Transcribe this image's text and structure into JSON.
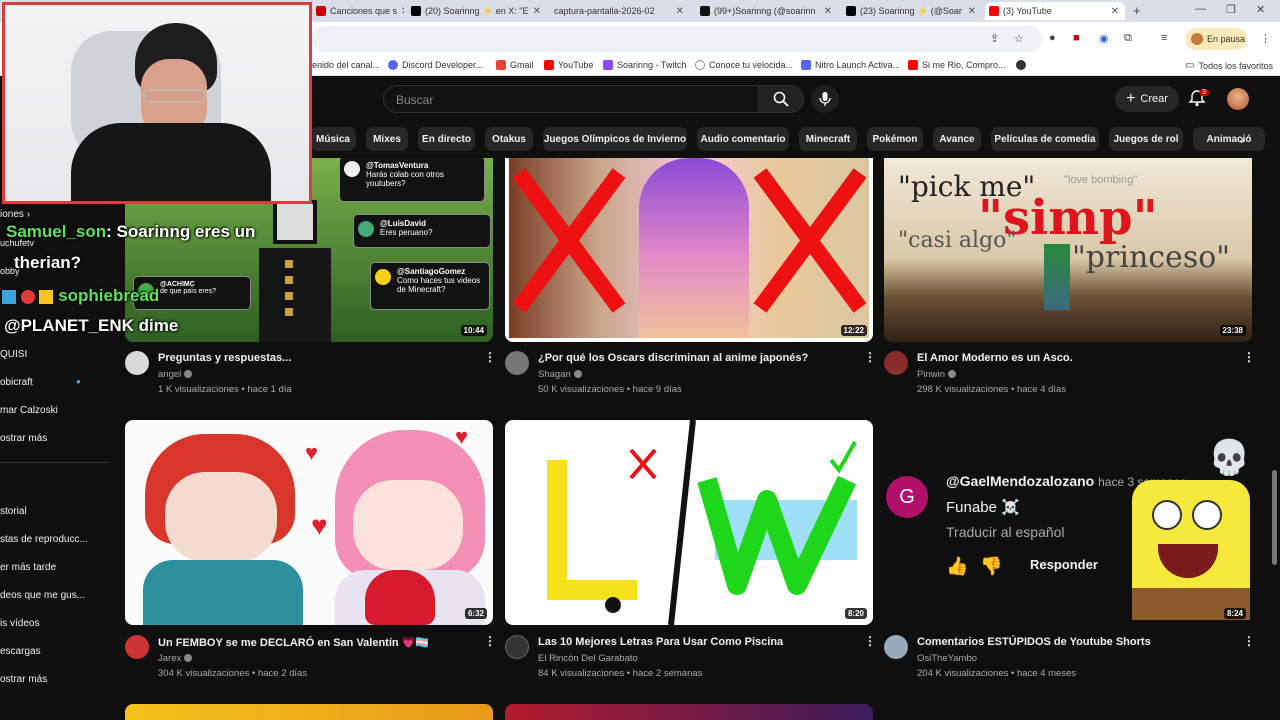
{
  "browser": {
    "tabs": [
      {
        "label": "Canciones que s"
      },
      {
        "label": "(20) Soarinng ⚡ en X: \"E"
      },
      {
        "label": "captura-pantalla-2026-02"
      },
      {
        "label": "(99+)Soarinng (@soarinn"
      },
      {
        "label": "(23) Soarinng ⚡ (@Soar"
      },
      {
        "label": "(3) YouTube"
      }
    ],
    "new_tab": "+",
    "pause_label": "En pausa",
    "bookmarks": [
      {
        "label": "enido del canal..."
      },
      {
        "label": "Discord Developer..."
      },
      {
        "label": "Gmail"
      },
      {
        "label": "YouTube"
      },
      {
        "label": "Soarinng - Twitch"
      },
      {
        "label": "Conoce tu velocida..."
      },
      {
        "label": "Nitro Launch Activa..."
      },
      {
        "label": "Si me Rio, Compro..."
      }
    ],
    "all_favorites": "Todos los favoritos"
  },
  "youtube": {
    "search_placeholder": "Buscar",
    "create_label": "Crear",
    "notif_count": "3",
    "chips": [
      "Música",
      "Mixes",
      "En directo",
      "Otakus",
      "Juegos Olímpicos de Invierno",
      "Audio comentario",
      "Minecraft",
      "Pokémon",
      "Avance",
      "Películas de comedia",
      "Juegos de rol",
      "Animació"
    ]
  },
  "sidebar": {
    "items": [
      "iones",
      "uchufetv",
      "obby",
      "QUISI",
      "obicraft",
      "mar Calzoski",
      "ostrar más",
      "storial",
      "stas de reproducc...",
      "er más tarde",
      "deos que me gus...",
      "is vídeos",
      "escargas",
      "ostrar más"
    ]
  },
  "videos": [
    {
      "title": "Preguntas y respuestas...",
      "channel": "angel",
      "meta": "1 K visualizaciones • hace 1 día",
      "duration": "10:44"
    },
    {
      "title": "¿Por qué los Oscars discriminan al anime japonés?",
      "channel": "Shagan",
      "meta": "50 K visualizaciones • hace 9 días",
      "duration": "12:22"
    },
    {
      "title": "El Amor Moderno es un Asco.",
      "channel": "Pinwin",
      "meta": "298 K visualizaciones • hace 4 días",
      "duration": "23:38"
    },
    {
      "title": "Un FEMBOY se me DECLARÓ en San Valentín 💗🏳️‍⚧️",
      "channel": "Jarex",
      "meta": "304 K visualizaciones • hace 2 días",
      "duration": "6:32"
    },
    {
      "title": "Las 10 Mejores Letras Para Usar Como Piscina",
      "channel": "El Rincón Del Garabato",
      "meta": "84 K visualizaciones • hace 2 semanas",
      "duration": "8:20"
    },
    {
      "title": "Comentarios ESTÚPIDOS de Youtube Shorts",
      "channel": "OsiTheYambo",
      "meta": "204 K visualizaciones • hace 4 meses",
      "duration": "8:24"
    }
  ],
  "thumb_text": {
    "simp_pick": "\"pick me\"",
    "simp_big": "\"simp\"",
    "simp_casi": "\"casi algo\"",
    "simp_princeso": "\"princeso\"",
    "simp_love": "\"love bombing\"",
    "comment_user": "@GaelMendozalozano",
    "comment_time": "hace 3 semanas",
    "comment_text": "Funabe ☠️",
    "comment_translate": "Traducir al español",
    "comment_reply": "Responder",
    "comment_avatar": "G",
    "qa_1_user": "@TomasVentura",
    "qa_1_text": "Harás colab con otros youtubers?",
    "qa_2_user": "@LuisDavid",
    "qa_2_text": "Eres peruano?",
    "qa_3_user": "@SantiagoGomez",
    "qa_3_text": "Como haces tus videos de Minecraft?",
    "qa_4_user": "@ACHIMC",
    "qa_4_text": "de que país eres?"
  },
  "chat": {
    "line1_user": "Samuel_son",
    "line1_text": ": Soarinng eres un",
    "line2": "therian?",
    "line3_user": "sophiebread",
    "line4": "@PLANET_ENK dime"
  }
}
